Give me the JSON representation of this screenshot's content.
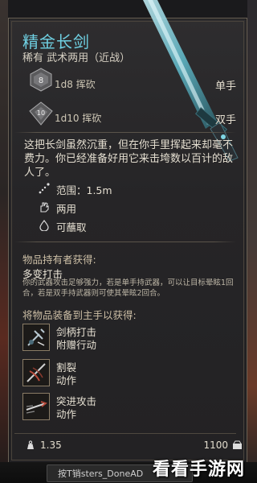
{
  "item": {
    "name": "精金长剑",
    "subtitle": "稀有 武术两用（近战）"
  },
  "damage": [
    {
      "die": "d8-die-icon",
      "die_label": "8",
      "text": "1d8 挥砍",
      "hand": "单手"
    },
    {
      "die": "d10-die-icon",
      "die_label": "10",
      "text": "1d10 挥砍",
      "hand": "双手"
    }
  ],
  "description": "这把长剑虽然沉重，但在你手里挥起来却毫不费力。你已经准备好用它来击垮数以百计的敌人了。",
  "properties": [
    {
      "icon": "range-icon",
      "label": "范围：1.5m"
    },
    {
      "icon": "two-hand-icon",
      "label": "两用"
    },
    {
      "icon": "pickpocket-icon",
      "label": "可蘸取"
    }
  ],
  "holder_section": {
    "title": "物品持有者获得:",
    "ability_name": "多变打击",
    "ability_desc": "你的武器攻击足够强力，若是单手持武器，可以让目标晕眩1回合，若是双手持武器则可使其晕眩2回合。"
  },
  "equip_section": {
    "title": "将物品装备到主手以获得:",
    "perks": [
      {
        "icon": "pommel-strike-icon",
        "line1": "剑柄打击",
        "line2": "附赠行动"
      },
      {
        "icon": "lacerate-icon",
        "line1": "割裂",
        "line2": "动作"
      },
      {
        "icon": "rush-attack-icon",
        "line1": "突进攻击",
        "line2": "动作"
      }
    ]
  },
  "footer": {
    "weight": "1.35",
    "price": "1100"
  },
  "hint": {
    "text": "按T销sters_DoneAD"
  },
  "watermark": "看看手游网",
  "colors": {
    "title": "#6fd0e2",
    "text": "#e4ded0",
    "border": "#6c6458"
  }
}
